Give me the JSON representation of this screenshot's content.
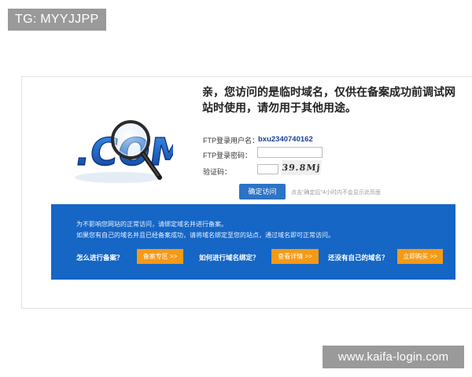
{
  "watermarks": {
    "top": "TG: MYYJJPP",
    "bottom": "www.kaifa-login.com"
  },
  "logo": {
    "text": ".COM"
  },
  "headline": "亲，您访问的是临时域名，仅供在备案成功前调试网站时使用，请勿用于其他用途。",
  "form": {
    "username_label": "FTP登录用户名：",
    "username_value": "bxu2340740162",
    "password_label": "FTP登录密码：",
    "password_value": "",
    "captcha_label": "验证码：",
    "captcha_value": "",
    "captcha_image_text": "39.8Mj",
    "confirm_label": "确定访问",
    "hint": "点击\"确定后\"4小时内不会显示此页面"
  },
  "notice": {
    "line1": "为不影响您网站的正常访问，请绑定域名并进行备案。",
    "line2": "如果您有自己的域名并且已经备案成功，请将域名绑定至您的站点，通过域名即可正常访问。"
  },
  "actions": [
    {
      "question": "怎么进行备案？",
      "button": "备案专区 >>"
    },
    {
      "question": "如何进行域名绑定？",
      "button": "查看详情 >>"
    },
    {
      "question": "还没有自己的域名？",
      "button": "立即购买 >>"
    }
  ],
  "colors": {
    "panel_blue": "#1566c5",
    "confirm_blue": "#2c74c5",
    "orange": "#f59a15",
    "username_blue": "#1a3e96"
  }
}
